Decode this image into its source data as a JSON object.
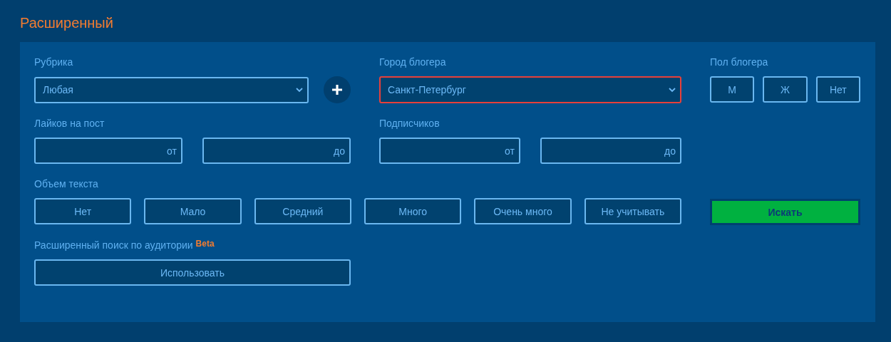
{
  "title": "Расширенный",
  "rubric": {
    "label": "Рубрика",
    "value": "Любая"
  },
  "city": {
    "label": "Город блогера",
    "value": "Санкт-Петербург",
    "invalid": true
  },
  "gender": {
    "label": "Пол блогера",
    "options": [
      "М",
      "Ж",
      "Нет"
    ]
  },
  "likes": {
    "label": "Лайков на пост",
    "from_placeholder": "от",
    "to_placeholder": "до"
  },
  "subscribers": {
    "label": "Подписчиков",
    "from_placeholder": "от",
    "to_placeholder": "до"
  },
  "text_volume": {
    "label": "Объем текста",
    "options": [
      "Нет",
      "Мало",
      "Средний",
      "Много",
      "Очень много",
      "Не учитывать"
    ]
  },
  "search_button": "Искать",
  "audience": {
    "label": "Расширенный поиск по аудитории",
    "badge": "Beta",
    "button": "Использовать"
  }
}
